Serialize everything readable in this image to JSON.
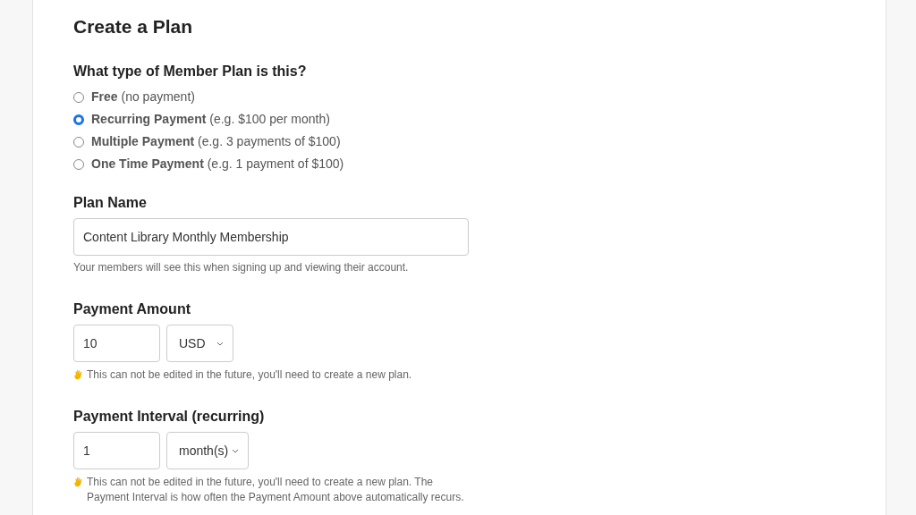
{
  "title": "Create a Plan",
  "plan_type": {
    "label": "What type of Member Plan is this?",
    "options": [
      {
        "label": "**Free** (no payment)",
        "selected": false
      },
      {
        "label": "**Recurring Payment** (e.g. $100 per month)",
        "selected": true
      },
      {
        "label": "**Multiple Payment** (e.g. 3 payments of $100)",
        "selected": false
      },
      {
        "label": "**One Time Payment** (e.g. 1 payment of $100)",
        "selected": false
      }
    ]
  },
  "plan_name": {
    "label": "Plan Name",
    "value": "Content Library Monthly Membership",
    "help": "Your members will see this when signing up and viewing their account."
  },
  "payment_amount": {
    "label": "Payment Amount",
    "value": "10",
    "select": "USD",
    "note": "This can not be edited in the future, you'll need to create a new plan."
  },
  "payment_interval": {
    "label": "Payment Interval (recurring)",
    "value": "1",
    "select": "month(s)",
    "note": "This can not be edited in the future, you'll need to create a new plan. The Payment Interval is how often the Payment Amount above automatically recurs."
  }
}
